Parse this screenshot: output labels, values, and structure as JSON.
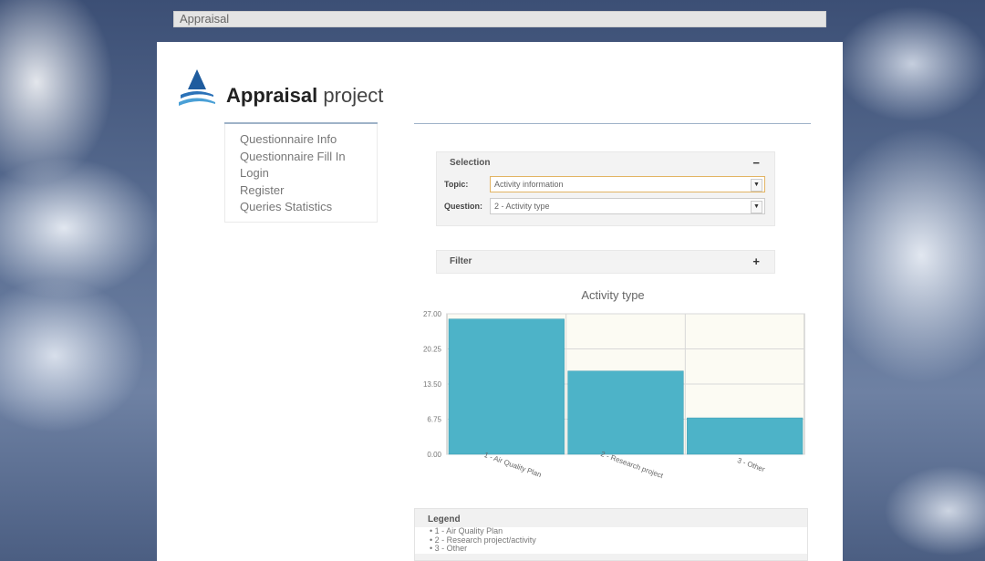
{
  "window": {
    "title": "Appraisal"
  },
  "brand": {
    "name_bold": "Appraisal",
    "name_light": "project"
  },
  "nav": {
    "items": [
      {
        "label": "Questionnaire Info"
      },
      {
        "label": "Questionnaire Fill In"
      },
      {
        "label": "Login"
      },
      {
        "label": "Register"
      },
      {
        "label": "Queries Statistics"
      }
    ]
  },
  "selection": {
    "header": "Selection",
    "toggle": "−",
    "topic_label": "Topic:",
    "topic_value": "Activity information",
    "question_label": "Question:",
    "question_value": "2 - Activity type"
  },
  "filter": {
    "header": "Filter",
    "toggle": "+"
  },
  "chart_data": {
    "type": "bar",
    "title": "Activity type",
    "categories": [
      "1 - Air Quality Plan",
      "2 - Research project",
      "3 - Other"
    ],
    "values": [
      26,
      16,
      7
    ],
    "yticks": [
      "0.00",
      "6.75",
      "13.50",
      "20.25",
      "27.00"
    ],
    "ylim": [
      0,
      27
    ],
    "bar_color": "#4db3c8",
    "plot_bg": "#fcfbf3",
    "grid": true
  },
  "legend": {
    "header": "Legend",
    "items": [
      "1 - Air Quality Plan",
      "2 - Research project/activity",
      "3 - Other"
    ]
  }
}
